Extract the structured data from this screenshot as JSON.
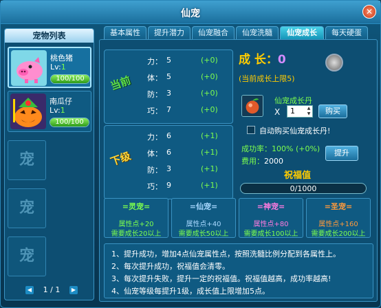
{
  "window": {
    "title": "仙宠",
    "close": "✕"
  },
  "pet_list": {
    "title": "宠物列表",
    "pets": [
      {
        "name": "桃色猪",
        "lv_label": "Lv:",
        "lv": "1",
        "hp": "100/100",
        "hp_fraction": 1.0
      },
      {
        "name": "南瓜仔",
        "lv_label": "Lv:",
        "lv": "1",
        "hp": "100/100",
        "hp_fraction": 1.0
      }
    ],
    "empty_label": "宠",
    "pager": "1 / 1"
  },
  "tabs": [
    "基本属性",
    "提升潜力",
    "仙宠融合",
    "仙宠洗髓",
    "仙宠成长",
    "每天硬蛋"
  ],
  "active_tab": 4,
  "current": {
    "label": "当前",
    "stats": [
      {
        "k": "力：",
        "v": "5",
        "d": "(+0)"
      },
      {
        "k": "体：",
        "v": "5",
        "d": "(+0)"
      },
      {
        "k": "防：",
        "v": "3",
        "d": "(+0)"
      },
      {
        "k": "巧：",
        "v": "7",
        "d": "(+0)"
      }
    ]
  },
  "next": {
    "label": "下级",
    "stats": [
      {
        "k": "力：",
        "v": "6",
        "d": "(+1)"
      },
      {
        "k": "体：",
        "v": "6",
        "d": "(+1)"
      },
      {
        "k": "防：",
        "v": "3",
        "d": "(+1)"
      },
      {
        "k": "巧：",
        "v": "9",
        "d": "(+1)"
      }
    ]
  },
  "growth": {
    "label": "成 长：",
    "value": "0",
    "cap": "(当前成长上限5)"
  },
  "item": {
    "name": "仙宠成长丹",
    "x": "X",
    "qty": "1",
    "buy": "购买"
  },
  "auto_buy": "自动购买仙宠成长丹!",
  "rate": {
    "label": "成功率：",
    "value": "100% (+0%)"
  },
  "cost": {
    "label": "费用：",
    "value": "2000"
  },
  "upgrade": "提升",
  "bless": {
    "title": "祝福值",
    "text": "0/1000",
    "fraction": 0.0
  },
  "tiers": [
    {
      "name": "=灵宠=",
      "bonus": "属性点+20",
      "req": "需要成长20以上",
      "color": "#7dff4e"
    },
    {
      "name": "=仙宠=",
      "bonus": "属性点+40",
      "req": "需要成长50以上",
      "color": "#a8d8ff"
    },
    {
      "name": "=神宠=",
      "bonus": "属性点+80",
      "req": "需要成长100以上",
      "color": "#ff7be0"
    },
    {
      "name": "=圣宠=",
      "bonus": "属性点+160",
      "req": "需要成长200以上",
      "color": "#ff9a3c"
    }
  ],
  "notes": [
    "1、提升成功，增加4点仙宠属性点，按照洗髓比例分配到各属性上。",
    "2、每次提升成功，祝福值会清零。",
    "3、每次提升失败，提升一定的祝福值。祝福值越高，成功率越高!",
    "4、仙宠等级每提升1级，成长值上限增加5点。"
  ],
  "colors": {
    "accent_green": "#7dff4e",
    "accent_gold": "#ffcc00",
    "growth_value": "#d48cff"
  }
}
